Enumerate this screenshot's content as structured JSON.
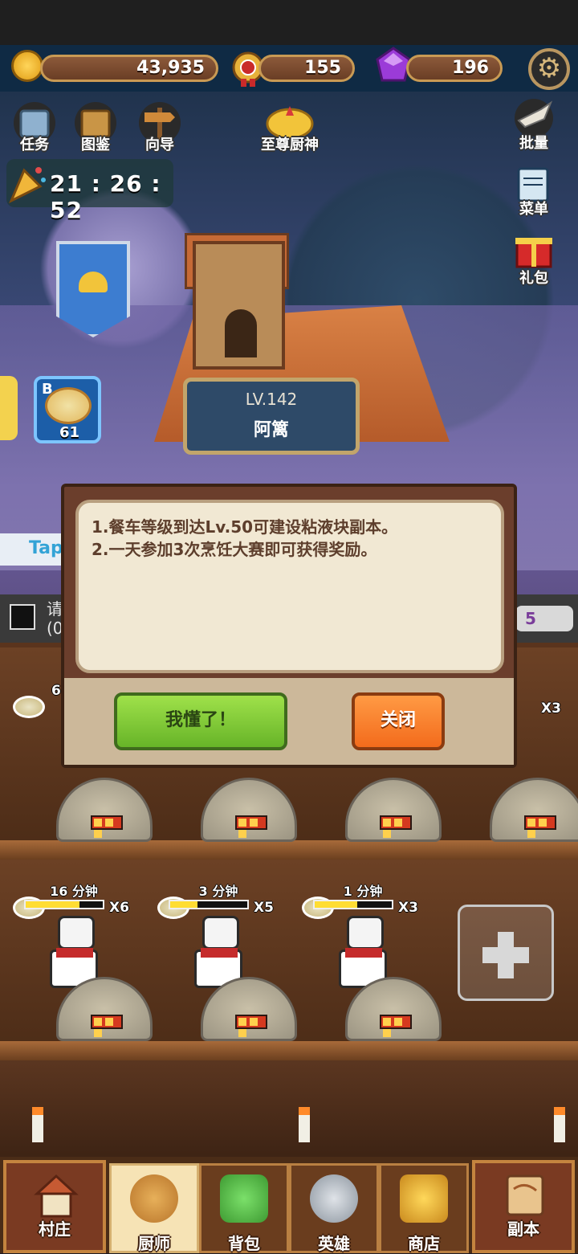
{
  "resources": {
    "coins": "43,935",
    "medals": "155",
    "gems": "196"
  },
  "top_buttons": {
    "tasks": "任务",
    "catalog": "图鉴",
    "guide": "向导",
    "supreme_chef": "至尊厨神",
    "batch": "批量",
    "menu": "菜单",
    "gift": "礼包"
  },
  "timer": "21 : 26 : 52",
  "restaurant": {
    "level": "LV.142",
    "name": "阿篱"
  },
  "pizza_card": {
    "badge": "B",
    "count": "61"
  },
  "strip": {
    "left_text_1": "请",
    "left_text_2": "(0",
    "right_value": "5",
    "tap_text": "Tap"
  },
  "dialog": {
    "line1": "1.餐车等级到达Lv.50可建设粘液块副本。",
    "line2": "2.一天参加3次烹饪大赛即可获得奖励。",
    "ok_label": "我懂了！",
    "close_label": "关闭"
  },
  "row1": {
    "left_partial": "6",
    "right_mult": "X3"
  },
  "row2": [
    {
      "time": "16 分钟",
      "mult": "X6",
      "progress": 0.7
    },
    {
      "time": "3 分钟",
      "mult": "X5",
      "progress": 0.35
    },
    {
      "time": "1 分钟",
      "mult": "X3",
      "progress": 0.55
    }
  ],
  "nav": {
    "village": "村庄",
    "chef": "厨师",
    "bag": "背包",
    "heroes": "英雄",
    "shop": "商店",
    "dungeon": "副本"
  },
  "colors": {
    "accent_green": "#67b428",
    "accent_orange": "#f36b1c",
    "gem_purple": "#9b3bd8"
  }
}
